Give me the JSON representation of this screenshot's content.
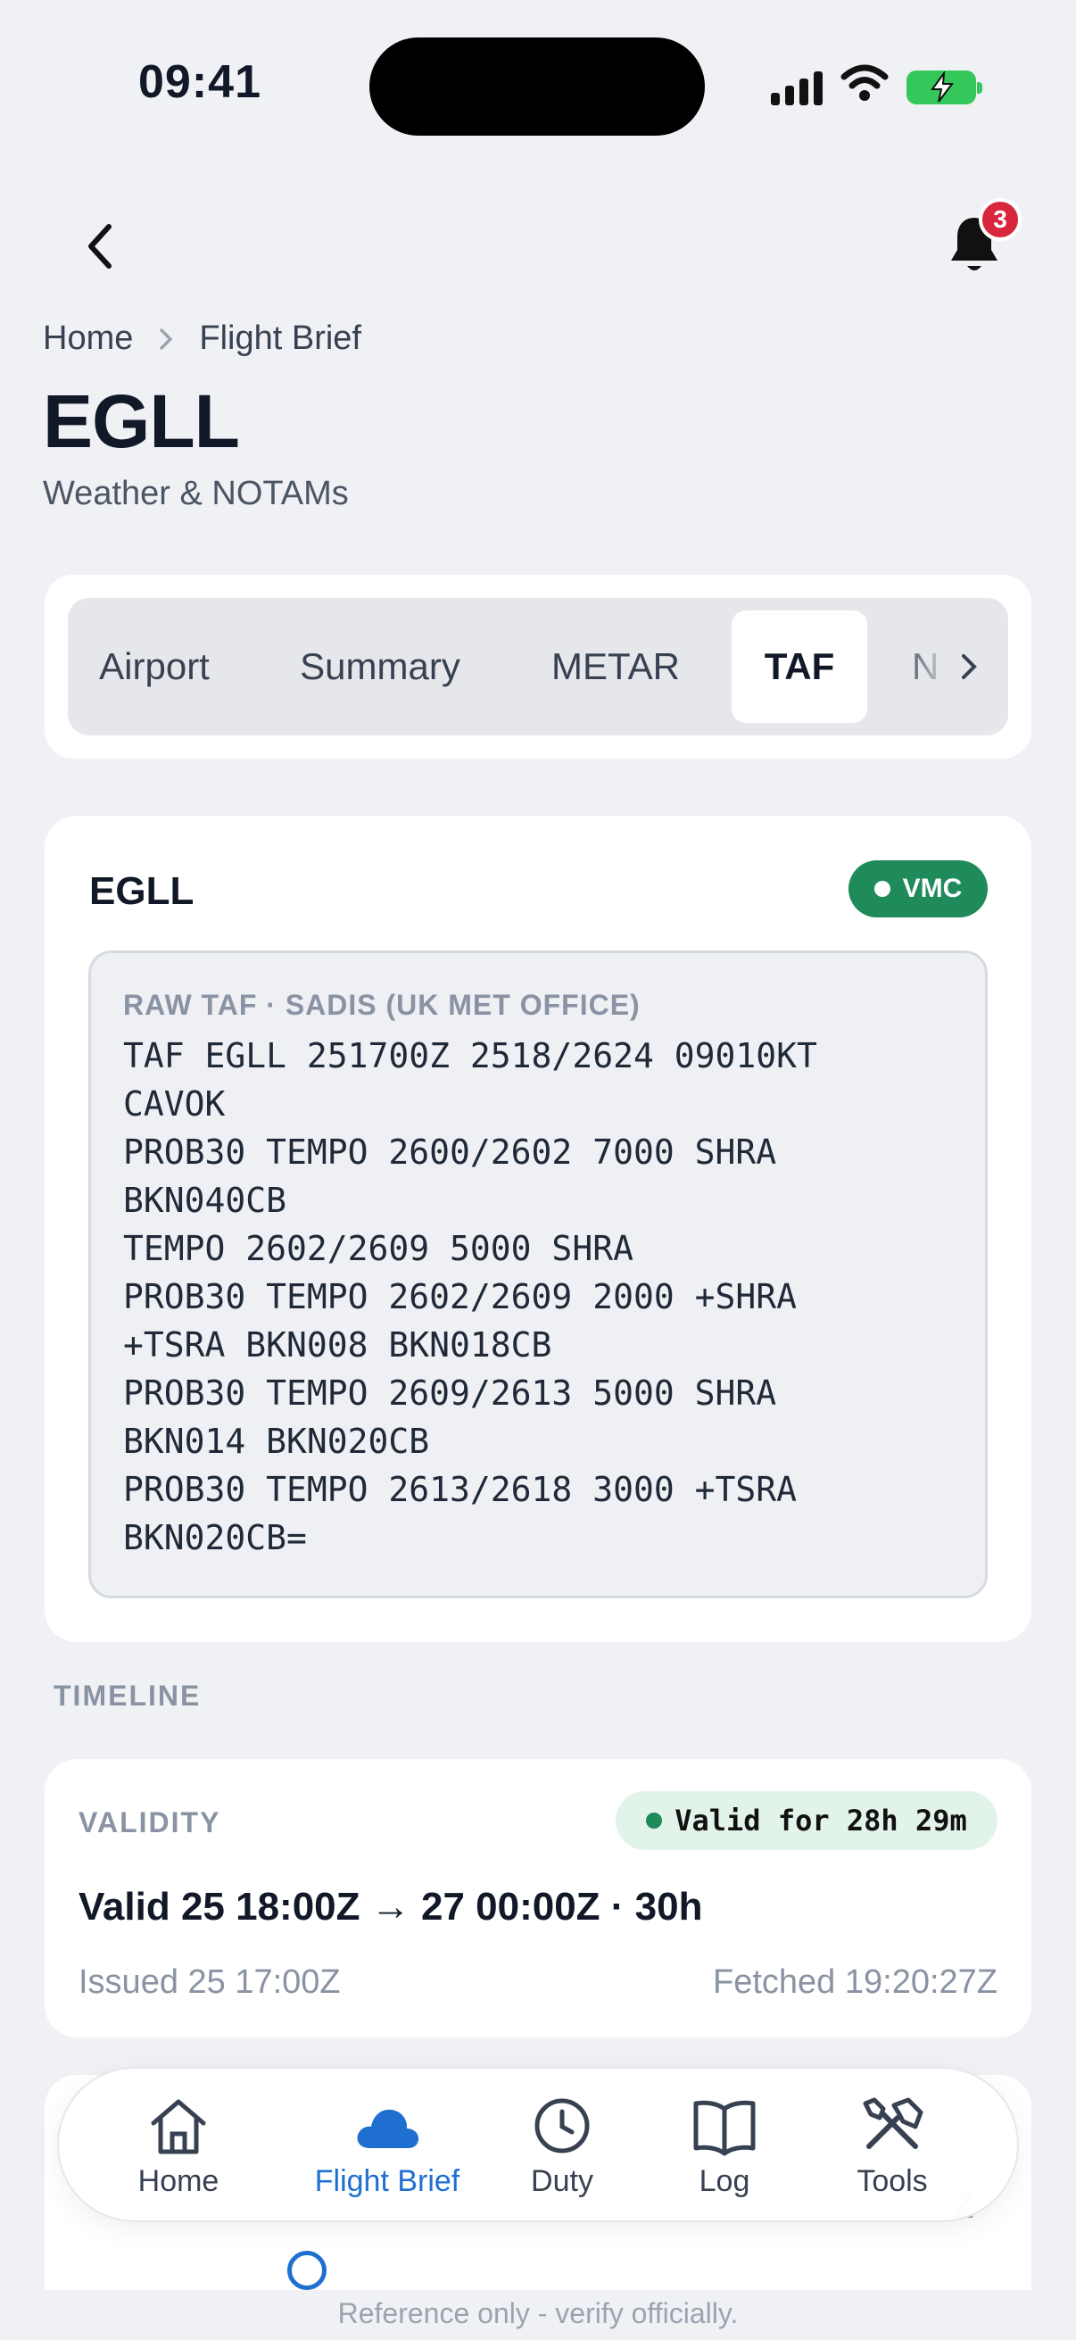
{
  "status_bar": {
    "time": "09:41"
  },
  "header": {
    "notification_count": "3"
  },
  "breadcrumb": {
    "items": [
      "Home",
      "Flight Brief"
    ]
  },
  "page": {
    "title": "EGLL",
    "subtitle": "Weather & NOTAMs"
  },
  "tabs": {
    "items": [
      "Airport",
      "Summary",
      "METAR",
      "TAF",
      "N"
    ],
    "active": "TAF"
  },
  "taf_card": {
    "station": "EGLL",
    "condition_badge": "VMC",
    "raw_label": "RAW TAF · SADIS (UK MET OFFICE)",
    "raw_text": "TAF EGLL 251700Z 2518/2624 09010KT\nCAVOK\nPROB30 TEMPO 2600/2602 7000 SHRA\nBKN040CB\nTEMPO 2602/2609 5000 SHRA\nPROB30 TEMPO 2602/2609 2000 +SHRA\n+TSRA BKN008 BKN018CB\nPROB30 TEMPO 2609/2613 5000 SHRA\nBKN014 BKN020CB\nPROB30 TEMPO 2613/2618 3000 +TSRA\nBKN020CB="
  },
  "timeline": {
    "section_label": "TIMELINE",
    "validity": {
      "label": "VALIDITY",
      "status": "Valid for 28h 29m",
      "period": "Valid 25 18:00Z → 27 00:00Z · 30h",
      "issued": "Issued 25 17:00Z",
      "fetched": "Fetched 19:20:27Z"
    },
    "next_card_fragment": "Z"
  },
  "nav": {
    "items": [
      {
        "label": "Home",
        "icon": "home-icon"
      },
      {
        "label": "Flight Brief",
        "icon": "cloud-icon"
      },
      {
        "label": "Duty",
        "icon": "clock-icon"
      },
      {
        "label": "Log",
        "icon": "book-icon"
      },
      {
        "label": "Tools",
        "icon": "tools-icon"
      }
    ],
    "active": "Flight Brief"
  },
  "footer": {
    "disclaimer": "Reference only - verify officially."
  },
  "colors": {
    "background": "#eff1f5",
    "accent": "#1f6fd1",
    "vmc_green": "#1f8a5a",
    "badge_red": "#d7263d",
    "battery_green": "#34c759"
  }
}
